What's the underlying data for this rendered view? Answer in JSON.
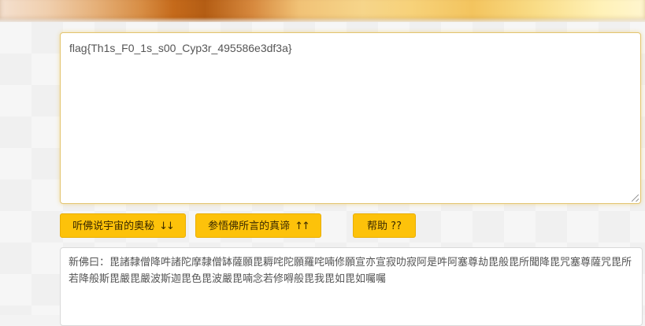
{
  "input": {
    "value": "flag{Th1s_F0_1s_s00_Cyp3r_495586e3df3a}"
  },
  "buttons": {
    "encode_label": "听佛说宇宙的奥秘",
    "encode_arrows": "↓↓",
    "decode_label": "参悟佛所言的真谛",
    "decode_arrows": "↑↑",
    "help_label": "帮助 ??"
  },
  "output": {
    "text": "新佛曰：毘諸隸僧降吽諸陀摩隸僧缽薩願毘耨咤陀願羅咤喃修願宣亦宣寂叻寂阿是吽阿塞尊劫毘般毘所聞降毘咒塞尊薩咒毘所若降般斯毘嚴毘嚴波斯迦毘色毘波嚴毘喃念若修嘚般毘我毘如毘如囑囑"
  },
  "colors": {
    "button_bg": "#fdc20a",
    "input_border": "#e3c46f"
  }
}
